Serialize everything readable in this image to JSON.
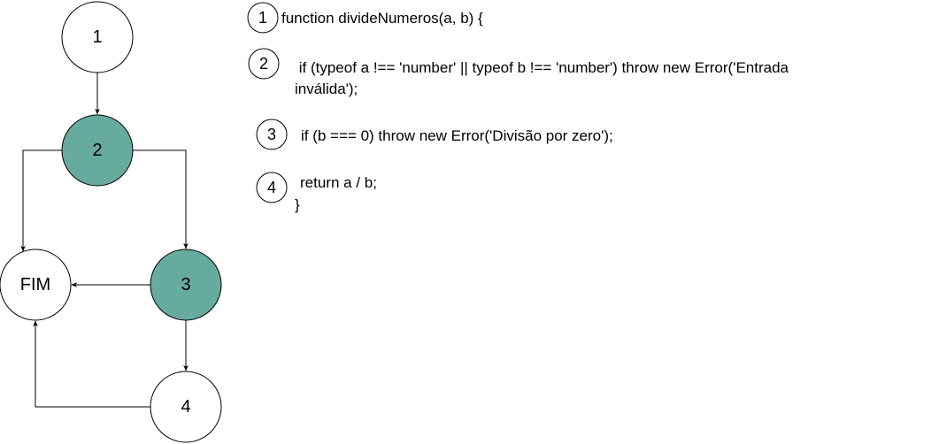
{
  "colors": {
    "highlight_fill": "#67AB9F",
    "default_fill": "#FFFFFF",
    "stroke": "#000000"
  },
  "graph": {
    "nodes": [
      {
        "id": "1",
        "label": "1",
        "highlighted": false
      },
      {
        "id": "2",
        "label": "2",
        "highlighted": true
      },
      {
        "id": "3",
        "label": "3",
        "highlighted": true
      },
      {
        "id": "4",
        "label": "4",
        "highlighted": false
      },
      {
        "id": "FIM",
        "label": "FIM",
        "highlighted": false
      }
    ],
    "edges": [
      {
        "from": "1",
        "to": "2"
      },
      {
        "from": "2",
        "to": "FIM"
      },
      {
        "from": "2",
        "to": "3"
      },
      {
        "from": "3",
        "to": "FIM"
      },
      {
        "from": "3",
        "to": "4"
      },
      {
        "from": "4",
        "to": "FIM"
      }
    ]
  },
  "code": {
    "lines": [
      {
        "num": "1",
        "text": "function divideNumeros(a, b) {"
      },
      {
        "num": "2",
        "text": " if (typeof a !== 'number' || typeof b !== 'number') throw new Error('Entrada",
        "text_cont": "inválida');"
      },
      {
        "num": "3",
        "text": "if (b === 0) throw new Error('Divisão por zero');"
      },
      {
        "num": "4",
        "text": "return a / b;",
        "text_cont": "}"
      }
    ]
  }
}
